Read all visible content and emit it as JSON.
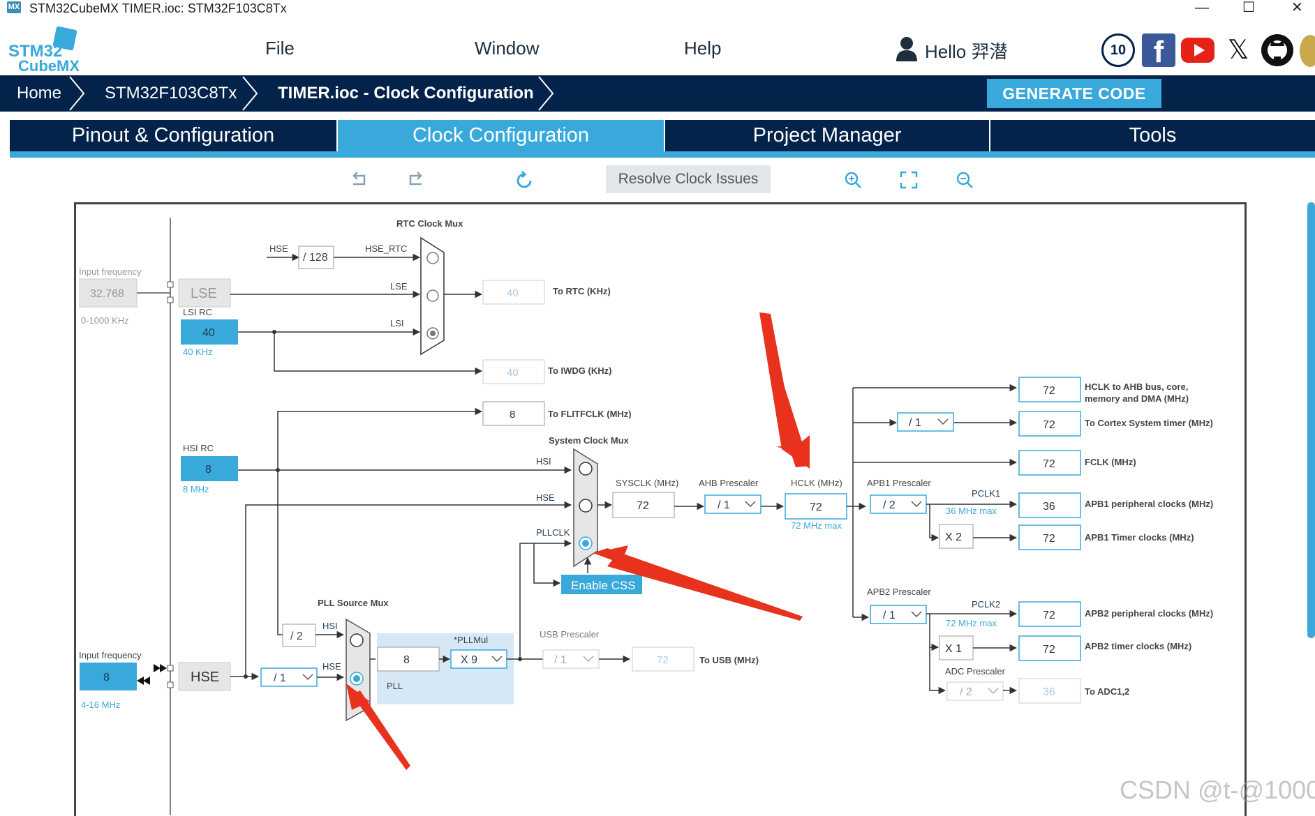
{
  "window": {
    "app_badge": "MX",
    "title": "STM32CubeMX TIMER.ioc: STM32F103C8Tx",
    "controls": [
      "—",
      "☐",
      "✕"
    ]
  },
  "logo": {
    "line1": "STM32",
    "line2": "CubeMX"
  },
  "menu": {
    "file": "File",
    "window": "Window",
    "help": "Help",
    "greeting": "Hello 羿潜"
  },
  "social": {
    "anniversary": "10",
    "facebook": "f",
    "x": "𝕏"
  },
  "breadcrumb": {
    "home": "Home",
    "device": "STM32F103C8Tx",
    "current": "TIMER.ioc - Clock Configuration"
  },
  "generate_code": "GENERATE CODE",
  "tabs": [
    "Pinout & Configuration",
    "Clock Configuration",
    "Project Manager",
    "Tools"
  ],
  "toolbar": {
    "resolve": "Resolve Clock Issues"
  },
  "clock": {
    "rtc_mux_title": "RTC Clock Mux",
    "hse": "HSE",
    "div128": "/ 128",
    "hse_rtc": "HSE_RTC",
    "lse_label": "LSE",
    "lsi_label": "LSI",
    "input_freq_label": "Input frequency",
    "lse_freq": "32.768",
    "lse_range": "0-1000 KHz",
    "lse": "LSE",
    "lsi_rc": "LSI RC",
    "lsi_value": "40",
    "lsi_unit": "40 KHz",
    "to_rtc_value": "40",
    "to_rtc": "To RTC (KHz)",
    "to_iwdg_value": "40",
    "to_iwdg": "To IWDG (KHz)",
    "flitf_value": "8",
    "to_flitf": "To FLITFCLK (MHz)",
    "sysclk_mux_title": "System Clock Mux",
    "hsi_rc": "HSI RC",
    "hsi_value": "8",
    "hsi_unit": "8 MHz",
    "hsi": "HSI",
    "pllclk": "PLLCLK",
    "sysclk_label": "SYSCLK (MHz)",
    "sysclk_value": "72",
    "ahb_label": "AHB Prescaler",
    "ahb_value": "/ 1",
    "hclk_label": "HCLK (MHz)",
    "hclk_value": "72",
    "hclk_max": "72 MHz max",
    "enable_css": "Enable CSS",
    "pll_mux_title": "PLL Source Mux",
    "hsi_div2": "/ 2",
    "input_freq_label2": "Input frequency",
    "hse_value": "8",
    "hse_range": "4-16 MHz",
    "hse_box": "HSE",
    "hse_prediv": "/ 1",
    "pll_in": "8",
    "pllmul_label": "*PLLMul",
    "pllmul_value": "X 9",
    "pll": "PLL",
    "usb_label": "USB Prescaler",
    "usb_prescaler": "/ 1",
    "usb_value": "72",
    "to_usb": "To USB (MHz)",
    "hclk_ahb_value": "72",
    "hclk_ahb_label": "HCLK to AHB bus, core,",
    "hclk_ahb_label2": "memory and DMA (MHz)",
    "cortex_div": "/ 1",
    "cortex_value": "72",
    "cortex_label": "To Cortex System timer (MHz)",
    "fclk_value": "72",
    "fclk_label": "FCLK (MHz)",
    "apb1_label": "APB1 Prescaler",
    "apb1_value": "/ 2",
    "pclk1": "PCLK1",
    "pclk1_max": "36 MHz max",
    "apb1_periph_value": "36",
    "apb1_periph_label": "APB1 peripheral clocks (MHz)",
    "apb1_x2": "X 2",
    "apb1_timer_value": "72",
    "apb1_timer_label": "APB1 Timer clocks (MHz)",
    "apb2_label": "APB2 Prescaler",
    "apb2_value": "/ 1",
    "pclk2": "PCLK2",
    "pclk2_max": "72 MHz max",
    "apb2_periph_value": "72",
    "apb2_periph_label": "APB2 peripheral clocks (MHz)",
    "apb2_x1": "X 1",
    "apb2_timer_value": "72",
    "apb2_timer_label": "APB2 timer clocks (MHz)",
    "adc_label": "ADC Prescaler",
    "adc_value": "/ 2",
    "adc_out_value": "36",
    "adc_out_label": "To ADC1,2"
  },
  "watermark": "CSDN @t-@1000",
  "colors": {
    "navy": "#03234b",
    "accent": "#39a9dc",
    "arrow": "#e8321e"
  }
}
